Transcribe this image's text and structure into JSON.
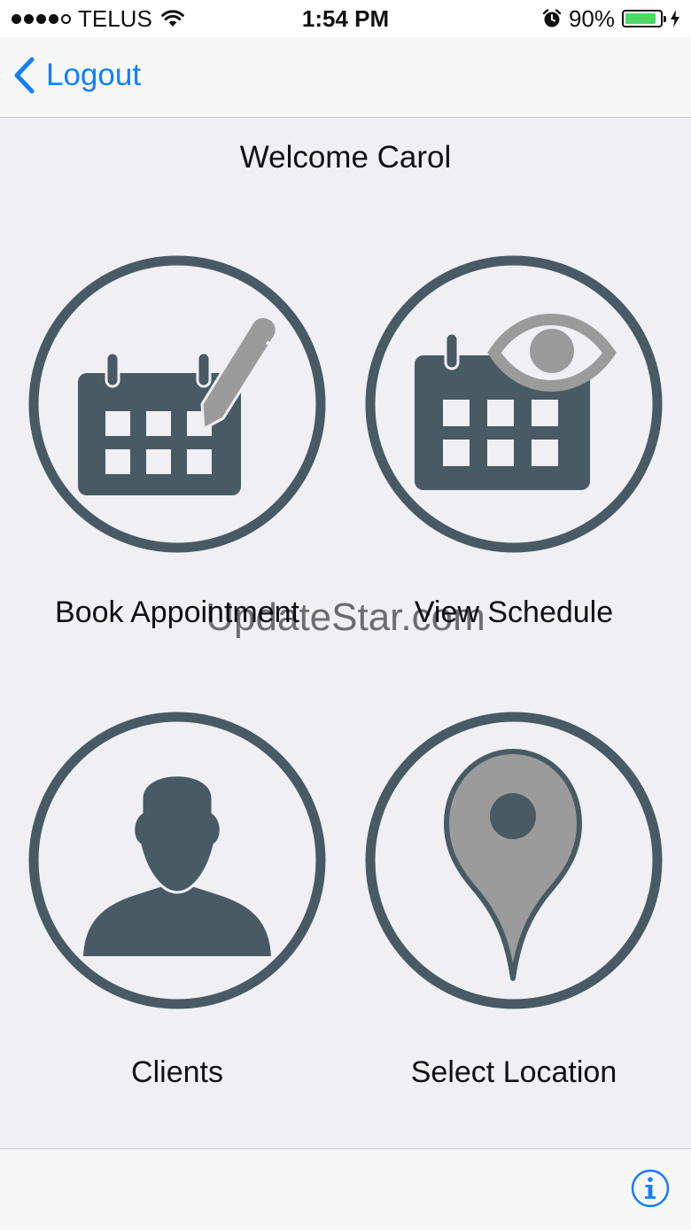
{
  "status_bar": {
    "carrier": "TELUS",
    "time": "1:54 PM",
    "battery_percent": "90%",
    "battery_level": 0.9,
    "icons": [
      "signal-dots-icon",
      "wifi-icon",
      "alarm-icon",
      "battery-icon",
      "charging-bolt-icon"
    ]
  },
  "nav": {
    "back_label": "Logout",
    "back_icon": "chevron-left-icon",
    "accent_color": "#147efb"
  },
  "welcome": "Welcome Carol",
  "tiles": [
    {
      "label": "Book Appointment",
      "icon": "calendar-pen-icon"
    },
    {
      "label": "View Schedule",
      "icon": "calendar-eye-icon"
    },
    {
      "label": "Clients",
      "icon": "person-icon"
    },
    {
      "label": "Select Location",
      "icon": "location-pin-icon"
    }
  ],
  "watermark": "UpdateStar.com",
  "bottom_bar": {
    "info_icon": "info-icon"
  },
  "colors": {
    "icon_dark": "#485a64",
    "icon_gray": "#9b9b9b",
    "background": "#efeff4"
  }
}
